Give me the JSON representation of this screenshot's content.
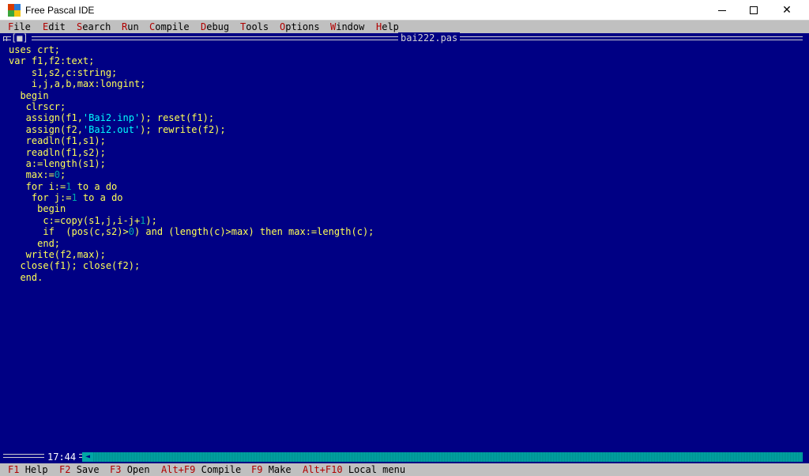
{
  "window": {
    "title": "Free Pascal IDE",
    "controls": {
      "minimize": "─",
      "maximize": "☐",
      "close": "✕"
    }
  },
  "menu": {
    "items": [
      {
        "hotkey": "F",
        "rest": "ile"
      },
      {
        "hotkey": "E",
        "rest": "dit"
      },
      {
        "hotkey": "S",
        "rest": "earch"
      },
      {
        "hotkey": "R",
        "rest": "un"
      },
      {
        "hotkey": "C",
        "rest": "ompile"
      },
      {
        "hotkey": "D",
        "rest": "ebug"
      },
      {
        "hotkey": "T",
        "rest": "ools"
      },
      {
        "hotkey": "O",
        "rest": "ptions"
      },
      {
        "hotkey": "W",
        "rest": "indow"
      },
      {
        "hotkey": "H",
        "rest": "elp"
      }
    ]
  },
  "editor": {
    "close_box": "[■]",
    "filename": "bai222.pas",
    "cursor_position": "17:44",
    "lines": [
      "uses crt;",
      "var f1,f2:text;",
      "    s1,s2,c:string;",
      "    i,j,a,b,max:longint;",
      "  begin",
      "   clrscr;",
      "   assign(f1,'Bai2.inp'); reset(f1);",
      "   assign(f2,'Bai2.out'); rewrite(f2);",
      "   readln(f1,s1);",
      "   readln(f1,s2);",
      "   a:=length(s1);",
      "   max:=0;",
      "   for i:=1 to a do",
      "    for j:=1 to a do",
      "     begin",
      "      c:=copy(s1,j,i-j+1);",
      "      if  (pos(c,s2)>0) and (length(c)>max) then max:=length(c);",
      "     end;",
      "   write(f2,max);",
      "  close(f1); close(f2);",
      "  end."
    ]
  },
  "status": {
    "items": [
      {
        "key": "F1",
        "label": "Help"
      },
      {
        "key": "F2",
        "label": "Save"
      },
      {
        "key": "F3",
        "label": "Open"
      },
      {
        "key": "Alt+F9",
        "label": "Compile"
      },
      {
        "key": "F9",
        "label": "Make"
      },
      {
        "key": "Alt+F10",
        "label": "Local menu"
      }
    ]
  },
  "colors": {
    "editor_bg": "#000084",
    "code_text": "#ffff55",
    "string_literal": "#00ffff",
    "number_literal": "#00aaaa",
    "menu_bg": "#c0c0c0",
    "hotkey": "#b00000"
  }
}
